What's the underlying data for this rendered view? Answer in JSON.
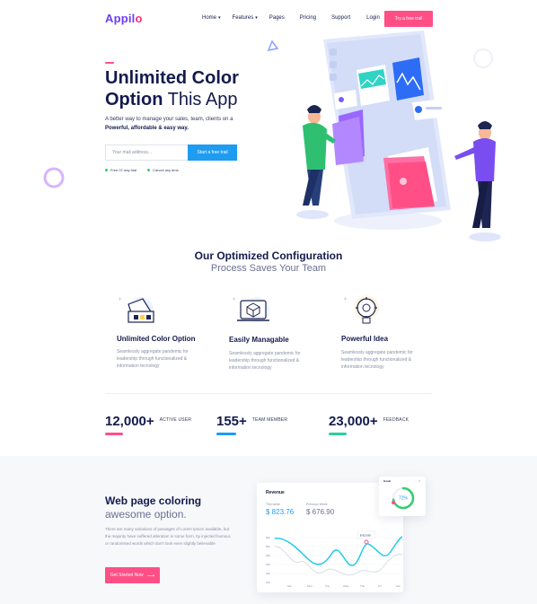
{
  "brand": {
    "name_main": "Appil",
    "name_accent": "o"
  },
  "nav": {
    "items": [
      {
        "label": "Home",
        "caret": "▾"
      },
      {
        "label": "Features",
        "caret": "▾"
      },
      {
        "label": "Pages",
        "caret": ""
      },
      {
        "label": "Pricing",
        "caret": ""
      },
      {
        "label": "Support",
        "caret": ""
      },
      {
        "label": "Login",
        "caret": ""
      }
    ],
    "cta": "Try a free trail"
  },
  "hero": {
    "title_line1": "Unlimited Color",
    "title_line2_bold": "Option",
    "title_line2_thin": " This App",
    "subtitle": "A better way to manage your sales, team, clients on a",
    "subtitle_bold": "Powerful, affordable & easy way.",
    "email_placeholder": "Your mail address...",
    "cta": "Start a free trail",
    "checks": [
      "Free 07-day trial",
      "Cancel any time"
    ]
  },
  "features_section": {
    "title": "Our Optimized Configuration",
    "subtitle": "Process Saves Your Team",
    "items": [
      {
        "icon": "color-palette-icon",
        "title": "Unlimited Color Option",
        "text": "Seamlessly aggregate pandemic for leadership through functionalized & information tecnology"
      },
      {
        "icon": "cube-laptop-icon",
        "title": "Easily Managable",
        "text": "Seamlessly aggregate pandemic for leadership through functionalized & information tecnology"
      },
      {
        "icon": "lightbulb-gear-icon",
        "title": "Powerful Idea",
        "text": "Seamlessly aggregate pandemic for leadership through functionalized & information tecnology"
      }
    ]
  },
  "stats": [
    {
      "number": "12,000+",
      "label": "ACTIVE USER",
      "color": "#ff4f86"
    },
    {
      "number": "155+",
      "label": "TEAM MEMBER",
      "color": "#1e9cf0"
    },
    {
      "number": "23,000+",
      "label": "FEEDBACK",
      "color": "#2fcfa0"
    }
  ],
  "web_section": {
    "title": "Web page coloring",
    "subtitle": "awesome option.",
    "text": "There are many variations of passages of Lorem Ipsum available, but the majority have suffered alteration in some form, by injected humour, or randomised words which don't look even slightly believable.",
    "cta": "Get Started Now",
    "cta_arrow": "⟶"
  },
  "revenue_card": {
    "title": "Revenue",
    "this_week_label": "This week",
    "this_week_value": "$ 823.76",
    "prev_week_label": "Previous Week",
    "prev_week_value": "$ 676.90",
    "tooltip": "$ 823.80",
    "y_ticks": [
      "60k",
      "50k",
      "40k",
      "30k",
      "20k",
      "10k"
    ],
    "x_ticks": [
      "Sat",
      "Mon",
      "Tue",
      "Wed",
      "Thu",
      "Fri",
      "Sat"
    ]
  },
  "progress_card": {
    "label": "Goals",
    "percent_text": "72%",
    "percent": 72
  },
  "colors": {
    "brand_purple": "#6f3cf5",
    "accent_pink": "#ff4f86",
    "accent_blue": "#1e9cf0",
    "accent_teal": "#2fcfa0",
    "navy": "#141b4d"
  }
}
